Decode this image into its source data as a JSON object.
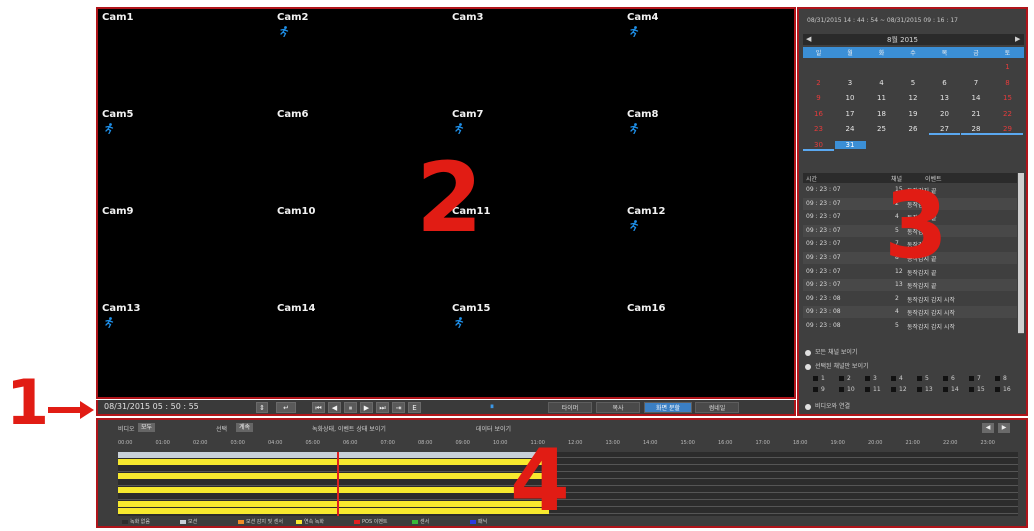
{
  "cameras": [
    {
      "label": "Cam1",
      "motion": false
    },
    {
      "label": "Cam2",
      "motion": true
    },
    {
      "label": "Cam3",
      "motion": false
    },
    {
      "label": "Cam4",
      "motion": true
    },
    {
      "label": "Cam5",
      "motion": true
    },
    {
      "label": "Cam6",
      "motion": false
    },
    {
      "label": "Cam7",
      "motion": true
    },
    {
      "label": "Cam8",
      "motion": true
    },
    {
      "label": "Cam9",
      "motion": false
    },
    {
      "label": "Cam10",
      "motion": false
    },
    {
      "label": "Cam11",
      "motion": false
    },
    {
      "label": "Cam12",
      "motion": true
    },
    {
      "label": "Cam13",
      "motion": true
    },
    {
      "label": "Cam14",
      "motion": false
    },
    {
      "label": "Cam15",
      "motion": true
    },
    {
      "label": "Cam16",
      "motion": false
    }
  ],
  "motion_icon": "running-person-icon",
  "callouts": {
    "one": "1",
    "two": "2",
    "three": "3",
    "four": "4"
  },
  "right_panel": {
    "range": "08/31/2015 14 : 44 : 54 ~ 08/31/2015 09 : 16 : 17",
    "month": "8월  2015",
    "prev": "◀",
    "next": "▶",
    "weekdays": [
      "일",
      "월",
      "화",
      "수",
      "목",
      "금",
      "토"
    ],
    "days": [
      {
        "d": "",
        "red": false
      },
      {
        "d": "",
        "red": false
      },
      {
        "d": "",
        "red": false
      },
      {
        "d": "",
        "red": false
      },
      {
        "d": "",
        "red": false
      },
      {
        "d": "",
        "red": false
      },
      {
        "d": "1",
        "red": true
      },
      {
        "d": "2",
        "red": true
      },
      {
        "d": "3",
        "red": false
      },
      {
        "d": "4",
        "red": false
      },
      {
        "d": "5",
        "red": false
      },
      {
        "d": "6",
        "red": false
      },
      {
        "d": "7",
        "red": false
      },
      {
        "d": "8",
        "red": true
      },
      {
        "d": "9",
        "red": true
      },
      {
        "d": "10",
        "red": false
      },
      {
        "d": "11",
        "red": false
      },
      {
        "d": "12",
        "red": false
      },
      {
        "d": "13",
        "red": false
      },
      {
        "d": "14",
        "red": false
      },
      {
        "d": "15",
        "red": true
      },
      {
        "d": "16",
        "red": true
      },
      {
        "d": "17",
        "red": false
      },
      {
        "d": "18",
        "red": false
      },
      {
        "d": "19",
        "red": false
      },
      {
        "d": "20",
        "red": false
      },
      {
        "d": "21",
        "red": false
      },
      {
        "d": "22",
        "red": true
      },
      {
        "d": "23",
        "red": true
      },
      {
        "d": "24",
        "red": false
      },
      {
        "d": "25",
        "red": false
      },
      {
        "d": "26",
        "red": false
      },
      {
        "d": "27",
        "red": false,
        "mark": true
      },
      {
        "d": "28",
        "red": false,
        "mark": true
      },
      {
        "d": "29",
        "red": true,
        "mark": true
      },
      {
        "d": "30",
        "red": true,
        "mark": true
      },
      {
        "d": "31",
        "red": false,
        "sel": true
      }
    ],
    "event_headers": {
      "time": "시간",
      "channel": "채널",
      "event": "이벤트"
    },
    "events": [
      {
        "time": "09 : 23 : 07",
        "ch": "15",
        "ev": "동작감지 끝"
      },
      {
        "time": "09 : 23 : 07",
        "ch": "2",
        "ev": "동작감지 끝"
      },
      {
        "time": "09 : 23 : 07",
        "ch": "4",
        "ev": "동작감지 끝"
      },
      {
        "time": "09 : 23 : 07",
        "ch": "5",
        "ev": "동작감지 끝"
      },
      {
        "time": "09 : 23 : 07",
        "ch": "7",
        "ev": "동작감지 끝"
      },
      {
        "time": "09 : 23 : 07",
        "ch": "8",
        "ev": "동작감지 끝"
      },
      {
        "time": "09 : 23 : 07",
        "ch": "12",
        "ev": "동작감지 끝"
      },
      {
        "time": "09 : 23 : 07",
        "ch": "13",
        "ev": "동작감지 끝"
      },
      {
        "time": "09 : 23 : 08",
        "ch": "2",
        "ev": "동작감지 감지 시작"
      },
      {
        "time": "09 : 23 : 08",
        "ch": "4",
        "ev": "동작감지 감지 시작"
      },
      {
        "time": "09 : 23 : 08",
        "ch": "5",
        "ev": "동작감지 감지 시작"
      }
    ],
    "options": [
      "모든 채널 보이기",
      "선택된 채널만 보이기",
      "비디오와 연결"
    ],
    "channels": [
      "1",
      "2",
      "3",
      "4",
      "5",
      "6",
      "7",
      "8",
      "9",
      "10",
      "11",
      "12",
      "13",
      "14",
      "15",
      "16"
    ]
  },
  "control_bar": {
    "datetime": "08/31/2015  05 : 50 : 55",
    "goto": "↵",
    "transport": [
      "⏮",
      "◀",
      "⏸",
      "▶",
      "⏭",
      "⇥",
      "E"
    ],
    "pause_indicator": "⏸",
    "modes": [
      {
        "label": "타이머",
        "active": false
      },
      {
        "label": "복사",
        "active": false
      },
      {
        "label": "화면 분할",
        "active": true
      },
      {
        "label": "썸네일",
        "active": false
      }
    ]
  },
  "timeline": {
    "label_a": "비디오",
    "select_a": "모두",
    "label_b": "선택",
    "select_b": "계속",
    "option_a": "녹화상태, 이벤트 상태 보이기",
    "option_b": "데이터 보이기",
    "hours": [
      "00:00",
      "01:00",
      "02:00",
      "03:00",
      "04:00",
      "05:00",
      "06:00",
      "07:00",
      "08:00",
      "09:00",
      "10:00",
      "11:00",
      "12:00",
      "13:00",
      "14:00",
      "15:00",
      "16:00",
      "17:00",
      "18:00",
      "19:00",
      "20:00",
      "21:00",
      "22:00",
      "23:00"
    ],
    "cursor_hour": 5.85,
    "recorded_until_hour": 11.5,
    "legend": [
      {
        "label": "녹화 없음",
        "color": "#2c2c2c"
      },
      {
        "label": "모션",
        "color": "#c8d0d8"
      },
      {
        "label": "모션 감지 및 센서",
        "color": "#f08c28"
      },
      {
        "label": "연속 녹화",
        "color": "#f7e92e"
      },
      {
        "label": "POS 이벤트",
        "color": "#e02020"
      },
      {
        "label": "센서",
        "color": "#38b838"
      },
      {
        "label": "패닉",
        "color": "#2a3ae0"
      }
    ]
  }
}
